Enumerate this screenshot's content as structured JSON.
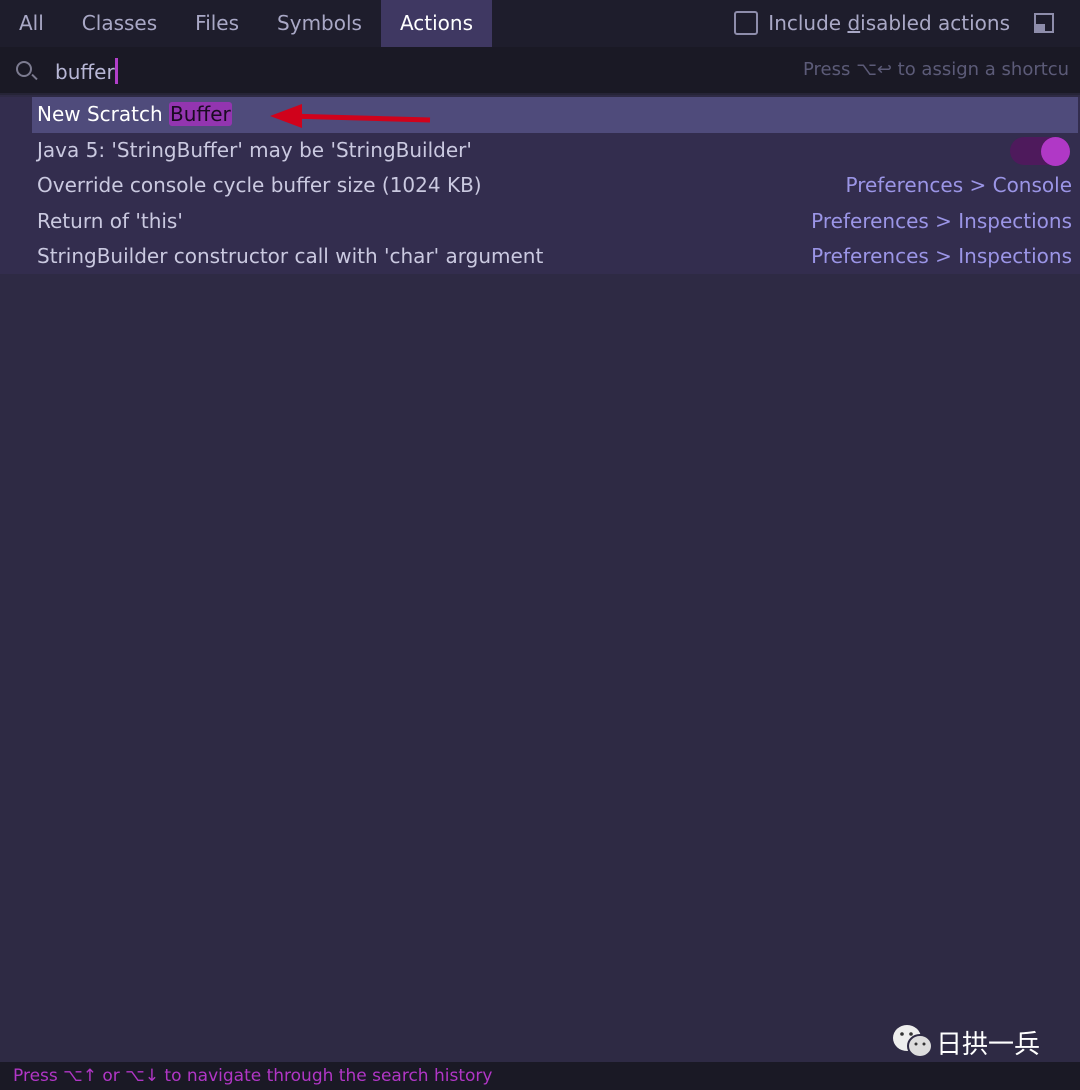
{
  "tabs": [
    {
      "label": "All"
    },
    {
      "label": "Classes"
    },
    {
      "label": "Files"
    },
    {
      "label": "Symbols"
    },
    {
      "label": "Actions",
      "active": true
    }
  ],
  "include_disabled": {
    "pre": "Include ",
    "u": "d",
    "post": "isabled actions",
    "checked": false
  },
  "search": {
    "value": "buffer",
    "hint": "Press ⌥↩ to assign a shortcu"
  },
  "results": [
    {
      "pre": "New Scratch ",
      "match": "Buffer",
      "selected": true
    },
    {
      "label": "Java 5: 'StringBuffer' may be 'StringBuilder'",
      "toggle": true
    },
    {
      "label": "Override console cycle buffer size (1024 KB)",
      "location": "Preferences > Console"
    },
    {
      "label": "Return of 'this'",
      "location": "Preferences > Inspections"
    },
    {
      "label": "StringBuilder constructor call with 'char' argument",
      "location": "Preferences > Inspections"
    }
  ],
  "footer": "Press ⌥↑ or ⌥↓ to navigate through the search history",
  "watermark": "日拱一兵",
  "colors": {
    "accent": "#b038c6",
    "selected": "#4f4b7b",
    "annotation_arrow": "#d0021b"
  }
}
